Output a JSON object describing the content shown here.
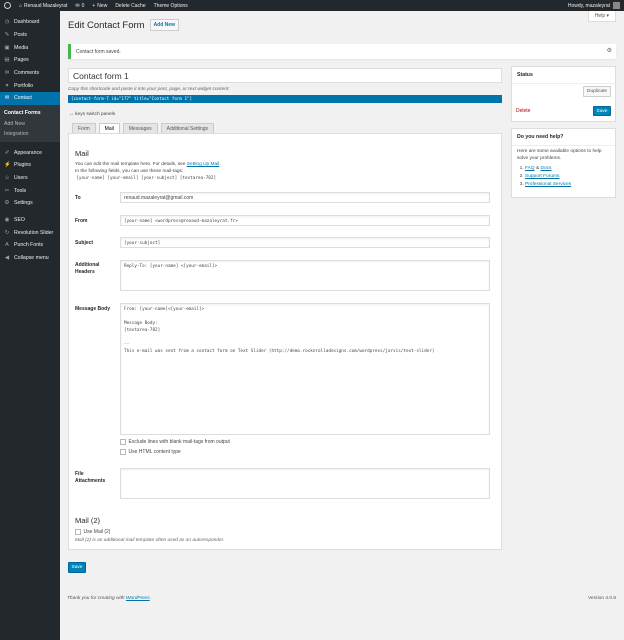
{
  "adminbar": {
    "site_name": "Renaud Mazaleyrat",
    "comments_count": "0",
    "new_label": "New",
    "delete_cache": "Delete Cache",
    "theme_options": "Theme Options",
    "greeting": "Howdy, mazaleyrat"
  },
  "sidebar": {
    "items": [
      {
        "label": "Dashboard",
        "icon": "dashboard-icon",
        "glyph": "◷"
      },
      {
        "label": "Posts",
        "icon": "pin-icon",
        "glyph": "✎"
      },
      {
        "label": "Media",
        "icon": "media-icon",
        "glyph": "▣"
      },
      {
        "label": "Pages",
        "icon": "page-icon",
        "glyph": "▤"
      },
      {
        "label": "Comments",
        "icon": "comment-icon",
        "glyph": "✉"
      },
      {
        "label": "Portfolio",
        "icon": "portfolio-icon",
        "glyph": "✦"
      },
      {
        "label": "Contact",
        "icon": "mail-icon",
        "glyph": "✉"
      }
    ],
    "submenu": [
      "Contact Forms",
      "Add New",
      "Integration"
    ],
    "items2": [
      {
        "label": "Appearance",
        "icon": "brush-icon",
        "glyph": "✐"
      },
      {
        "label": "Plugins",
        "icon": "plug-icon",
        "glyph": "⚡"
      },
      {
        "label": "Users",
        "icon": "users-icon",
        "glyph": "☺"
      },
      {
        "label": "Tools",
        "icon": "wrench-icon",
        "glyph": "✂"
      },
      {
        "label": "Settings",
        "icon": "settings-icon",
        "glyph": "⚙"
      }
    ],
    "items3": [
      {
        "label": "SEO",
        "icon": "seo-icon",
        "glyph": "◉"
      },
      {
        "label": "Revolution Slider",
        "icon": "refresh-icon",
        "glyph": "↻"
      },
      {
        "label": "Punch Fonts",
        "icon": "font-icon",
        "glyph": "A"
      },
      {
        "label": "Collapse menu",
        "icon": "collapse-icon",
        "glyph": "◀"
      }
    ]
  },
  "header": {
    "title": "Edit Contact Form",
    "add_new": "Add New",
    "help": "Help ▾"
  },
  "notice": {
    "text": "Contact form saved."
  },
  "form": {
    "title": "Contact form 1",
    "shortcode_label": "Copy this shortcode and paste it into your post, page, or text widget content:",
    "shortcode": "[contact-form-7 id=\"177\" title=\"Contact form 1\"]",
    "keys_switch": "keys switch panels"
  },
  "tabs": [
    "Form",
    "Mail",
    "Messages",
    "Additional Settings"
  ],
  "mail": {
    "heading": "Mail",
    "desc1": "You can edit the mail template here. For details, see ",
    "desc_link": "Setting Up Mail",
    "desc1_end": ".",
    "desc2": "In the following fields, you can use these mail-tags:",
    "tags": "[your-name] [your-email] [your-subject] [textarea-782]",
    "to_label": "To",
    "to_value": "renaud.mazaleyrat@gmail.com",
    "from_label": "From",
    "from_value": "[your-name] <wordpress@renaud-mazaleyrat.fr>",
    "subject_label": "Subject",
    "subject_value": "[your-subject]",
    "headers_label": "Additional Headers",
    "headers_value": "Reply-To: [your-name] <[your-email]>",
    "body_label": "Message Body",
    "body_value": "From: [your-name]<[your-email]>\n\nMessage Body:\n[textarea-782]\n\n--\nThis e-mail was sent from a contact form on Text Slider (http://demo.rocknrolladesigns.com/wordpress/jarvis/text-slider)",
    "exclude_blank": "Exclude lines with blank mail-tags from output",
    "use_html": "Use HTML content type",
    "attachments_label": "File Attachments",
    "attachments_value": ""
  },
  "mail2": {
    "heading": "Mail (2)",
    "use_label": "Use Mail (2)",
    "note": "Mail (2) is an additional mail template often used as an autoresponder."
  },
  "save_label": "Save",
  "status_box": {
    "title": "Status",
    "duplicate": "Duplicate",
    "delete": "Delete",
    "save": "Save"
  },
  "help_box": {
    "title": "Do you need help?",
    "text": "Here are some available options to help solve your problems.",
    "link1a": "FAQ",
    "link1_sep": " & ",
    "link1b": "Docs",
    "link2": "Support Forums",
    "link3": "Professional Services"
  },
  "footer": {
    "thanks": "Thank you for creating with ",
    "wp_link": "WordPress",
    "thanks_end": ".",
    "version": "Version 4.0.8"
  }
}
